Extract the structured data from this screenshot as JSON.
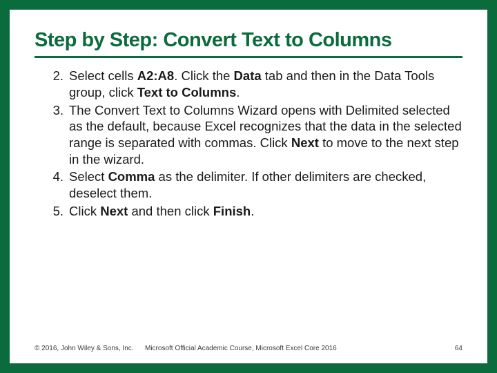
{
  "title": "Step by Step: Convert Text to Columns",
  "steps": [
    {
      "n": "2.",
      "segments": [
        {
          "t": "Select cells "
        },
        {
          "t": "A2:A8",
          "b": true
        },
        {
          "t": ". Click the "
        },
        {
          "t": "Data",
          "b": true
        },
        {
          "t": " tab and then in the Data Tools group, click "
        },
        {
          "t": "Text to Columns",
          "b": true
        },
        {
          "t": "."
        }
      ]
    },
    {
      "n": "3.",
      "segments": [
        {
          "t": "The Convert Text to Columns Wizard opens with Delimited selected as the default, because Excel recognizes that the data in the selected range is separated with commas. Click "
        },
        {
          "t": "Next",
          "b": true
        },
        {
          "t": " to move to the next step in the wizard."
        }
      ]
    },
    {
      "n": "4.",
      "segments": [
        {
          "t": "Select "
        },
        {
          "t": "Comma",
          "b": true
        },
        {
          "t": " as the delimiter. If other delimiters are checked, deselect them."
        }
      ]
    },
    {
      "n": "5.",
      "segments": [
        {
          "t": "Click "
        },
        {
          "t": "Next",
          "b": true
        },
        {
          "t": " and then click "
        },
        {
          "t": "Finish",
          "b": true
        },
        {
          "t": "."
        }
      ]
    }
  ],
  "footer": {
    "copyright": "© 2016, John Wiley & Sons, Inc.",
    "course": "Microsoft Official Academic Course, Microsoft Excel Core 2016",
    "page": "64"
  }
}
